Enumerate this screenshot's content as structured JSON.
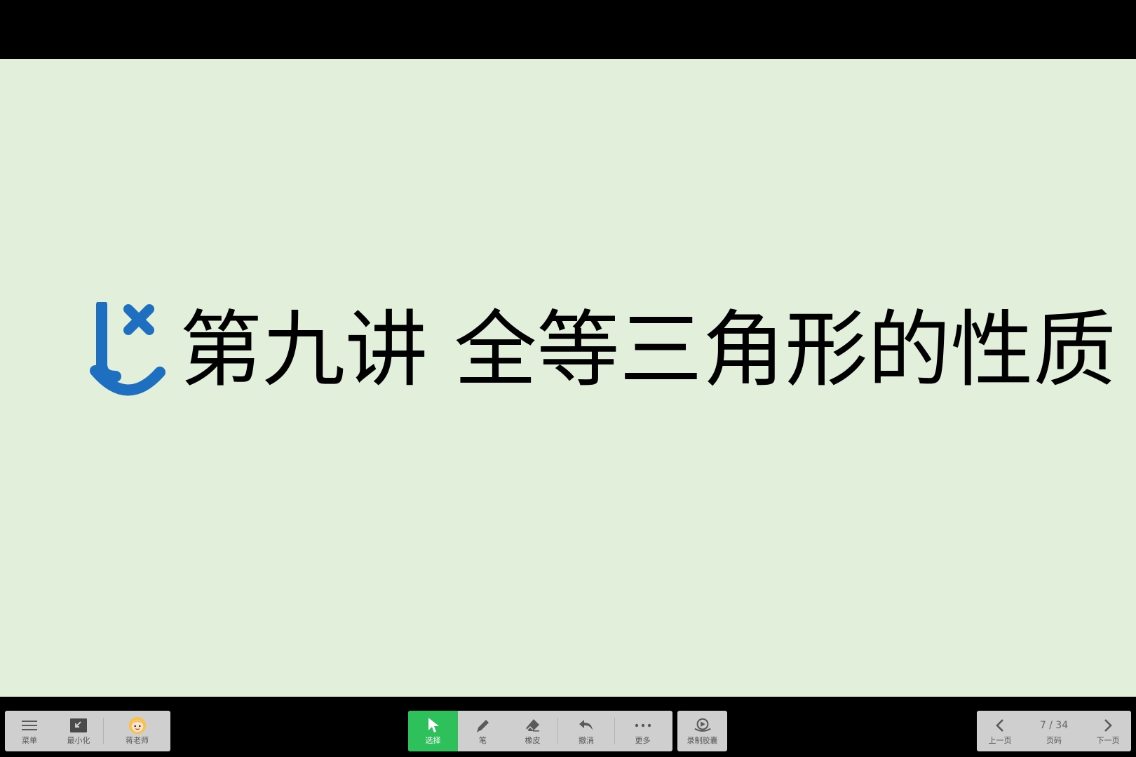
{
  "slide": {
    "title": "第九讲 全等三角形的性质",
    "background": "#e2efda",
    "logo_color": "#1f6fc0"
  },
  "toolbar_left": {
    "menu_label": "菜单",
    "minimize_label": "最小化",
    "teacher_label": "蒋老师"
  },
  "toolbar_center": {
    "select_label": "选择",
    "pen_label": "笔",
    "eraser_label": "橡皮",
    "undo_label": "撤消",
    "more_label": "更多",
    "active_color": "#2ec05a"
  },
  "toolbar_record": {
    "record_label": "录制胶囊"
  },
  "pager": {
    "prev_label": "上一页",
    "page_label": "页码",
    "next_label": "下一页",
    "current": "7",
    "separator": " / ",
    "total": "34"
  },
  "icons": {
    "menu": "hamburger-icon",
    "minimize": "minimize-icon",
    "teacher": "teacher-avatar-icon",
    "select": "cursor-icon",
    "pen": "pen-icon",
    "eraser": "eraser-icon",
    "undo": "undo-icon",
    "more": "more-dots-icon",
    "record": "record-capsule-icon",
    "prev": "chevron-left-icon",
    "next": "chevron-right-icon"
  }
}
